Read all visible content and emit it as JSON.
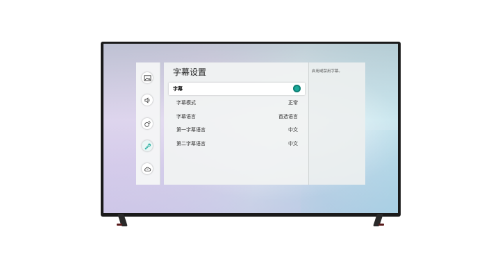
{
  "settings": {
    "title": "字幕设置",
    "description": "启用或禁用字幕。",
    "items": [
      {
        "label": "字幕",
        "value": "",
        "toggle": "on"
      },
      {
        "label": "字幕模式",
        "value": "正常"
      },
      {
        "label": "字幕语言",
        "value": "首选语言"
      },
      {
        "label": "第一字幕语言",
        "value": "中文"
      },
      {
        "label": "第二字幕语言",
        "value": "中文"
      }
    ]
  },
  "sidebar": {
    "icons": [
      "picture-icon",
      "sound-icon",
      "broadcasting-icon",
      "general-wrench-icon",
      "support-cloud-icon"
    ]
  },
  "colors": {
    "accent": "#1aa99a",
    "bezel": "#1a1a1a"
  }
}
